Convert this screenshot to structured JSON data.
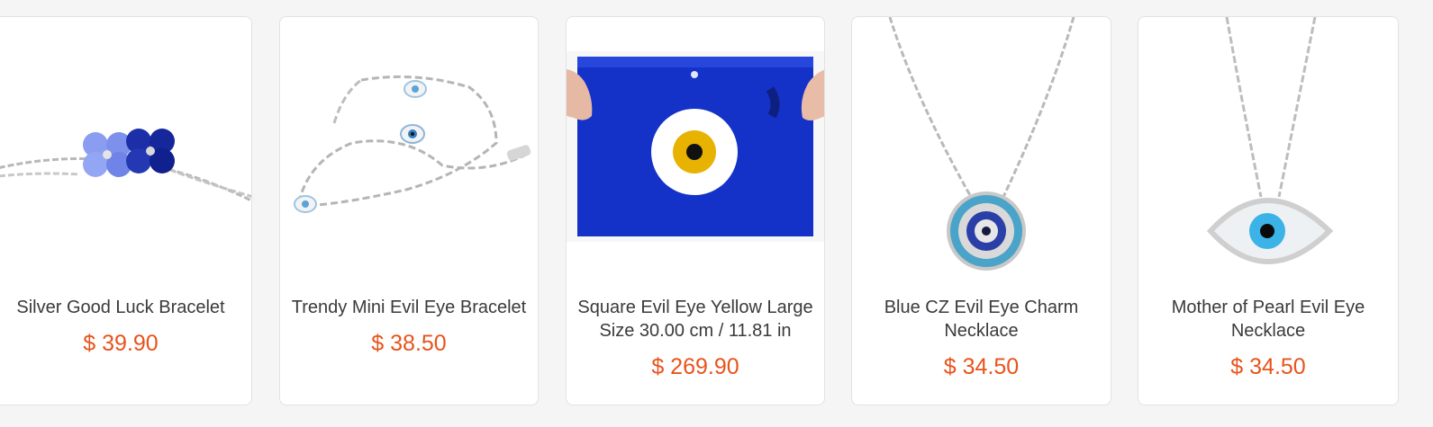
{
  "products": [
    {
      "name": "Silver Good Luck Bracelet",
      "price": "$ 39.90",
      "image": "clover-charm-bracelet"
    },
    {
      "name": "Trendy Mini Evil Eye Bracelet",
      "price": "$ 38.50",
      "image": "mini-evil-eye-chain-bracelet"
    },
    {
      "name": "Square Evil Eye Yellow Large Size 30.00 cm / 11.81 in",
      "price": "$ 269.90",
      "image": "square-blue-glass-evil-eye"
    },
    {
      "name": "Blue CZ Evil Eye Charm Necklace",
      "price": "$ 34.50",
      "image": "round-cz-evil-eye-necklace"
    },
    {
      "name": "Mother of Pearl Evil Eye Necklace",
      "price": "$ 34.50",
      "image": "pearl-eye-pendant-necklace"
    }
  ],
  "colors": {
    "price": "#e8531c",
    "name": "#3a3a3a",
    "card_border": "#e2e2e2",
    "glass_blue": "#1432c8"
  }
}
